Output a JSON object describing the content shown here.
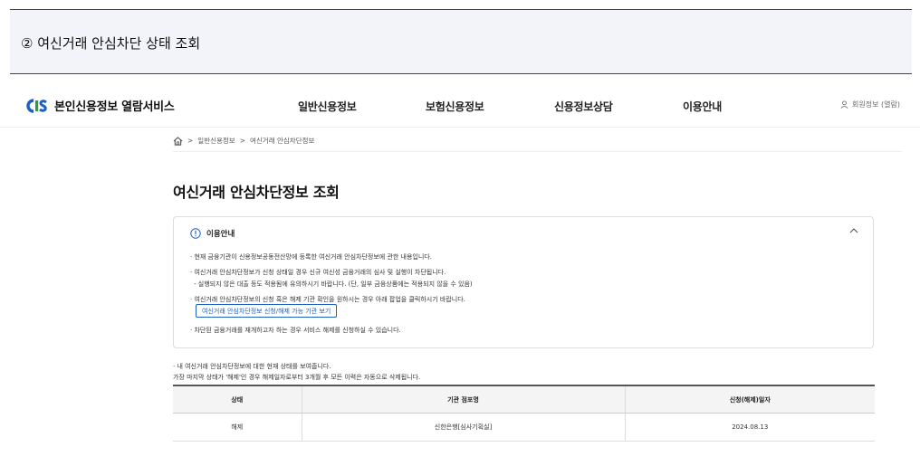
{
  "banner": {
    "title": "② 여신거래 안심차단 상태 조회"
  },
  "header": {
    "logo_text": "본인신용정보 열람서비스",
    "nav": [
      "일반신용정보",
      "보험신용정보",
      "신용정보상담",
      "이용안내"
    ],
    "member_label": "회원정보 (열람)",
    "brand_colors": {
      "blue": "#1f5fbf",
      "green": "#2e9b3e"
    }
  },
  "breadcrumb": {
    "items": [
      "일반신용정보",
      "여신거래 안심차단정보"
    ],
    "separator": ">"
  },
  "page": {
    "title": "여신거래 안심차단정보 조회"
  },
  "info": {
    "heading": "이용안내",
    "lines": [
      "· 현재 금융기관이 신용정보공동전산망에 등록한 여신거래 안심차단정보에 관한 내용입니다.",
      "· 여신거래 안심차단정보가 신청 상태일 경우 신규 여신성 금융거래의 심사 및 실행이 차단됩니다.",
      "- 실행되지 않은 대출 등도 적용됨에 유의하시기 바랍니다. (단, 일부 금융상품에는 적용되지 않을 수 있음)",
      "· 여신거래 안심차단정보의 신청 혹은 해제 기관 확인을 원하시는 경우 아래 팝업을 클릭하시기 바랍니다.",
      "· 차단된 금융거래를 재개하고자 하는 경우 서비스 해제를 신청하실 수 있습니다."
    ],
    "button_label": "여신거래 안심차단정보 신청/해제 가능 기관 보기"
  },
  "notes": [
    "· 내 여신거래 안심차단정보에 대한 현재 상태를 보여줍니다.",
    "가장 마지막 상태가 '해제'인 경우 해제일자로부터 3개월 후 모든 이력은 자동으로 삭제됩니다."
  ],
  "table": {
    "headers": [
      "상태",
      "기관 점포명",
      "신청(해제)일자"
    ],
    "rows": [
      [
        "해제",
        "신한은행[심사기획실]",
        "2024.08.13"
      ]
    ]
  }
}
